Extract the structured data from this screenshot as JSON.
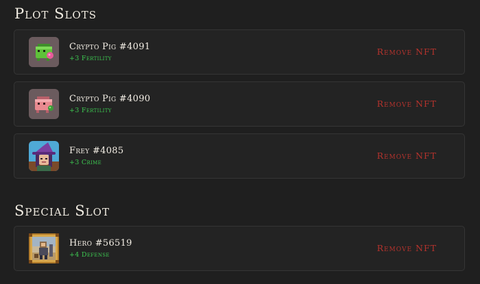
{
  "plot_section": {
    "title": "Plot Slots",
    "items": [
      {
        "name": "Crypto Pig #4091",
        "bonus": "+3 Fertility",
        "action": "Remove NFT",
        "icon": "green-pig-icon"
      },
      {
        "name": "Crypto Pig #4090",
        "bonus": "+3 Fertility",
        "action": "Remove NFT",
        "icon": "pink-pig-icon"
      },
      {
        "name": "Frey #4085",
        "bonus": "+3 Crime",
        "action": "Remove NFT",
        "icon": "witch-portrait-icon"
      }
    ]
  },
  "special_section": {
    "title": "Special Slot",
    "items": [
      {
        "name": "Hero #56519",
        "bonus": "+4 Defense",
        "action": "Remove NFT",
        "icon": "hero-card-icon"
      }
    ]
  },
  "colors": {
    "background": "#1f1f1f",
    "card": "#232323",
    "bonus_green": "#3ecb52",
    "remove_red": "#b5332d"
  }
}
